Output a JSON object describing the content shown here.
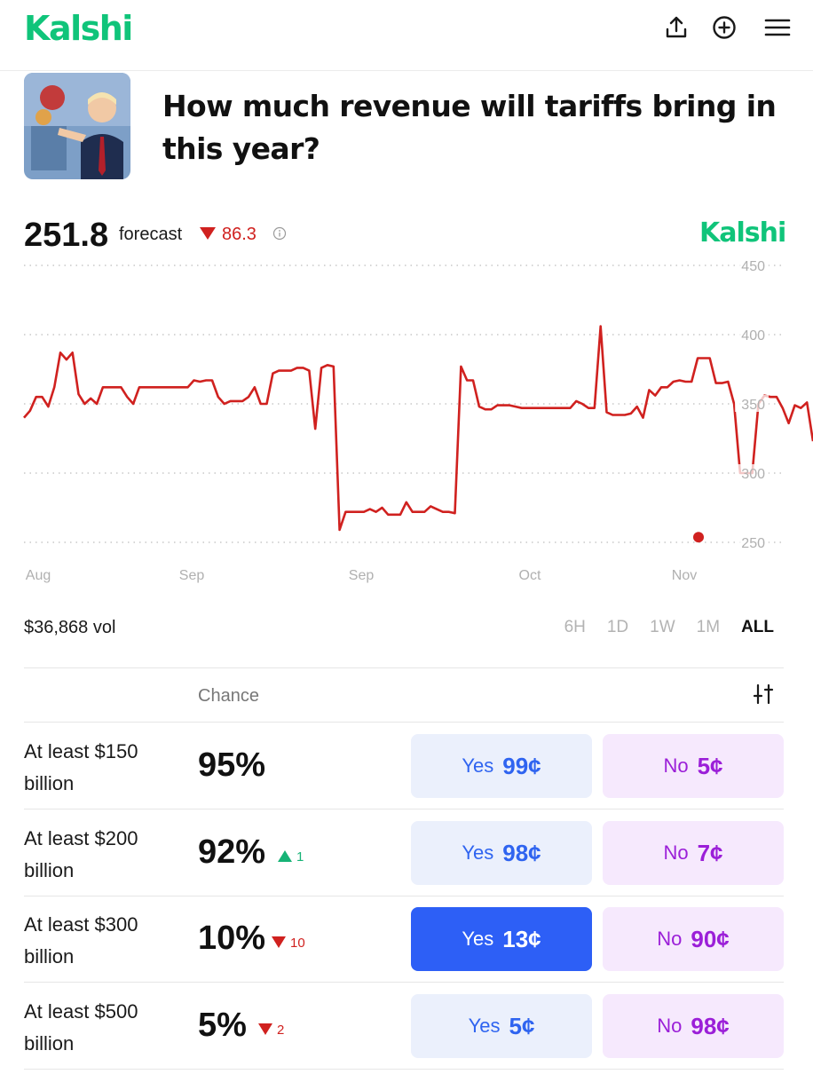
{
  "header": {
    "logo": "Kalshi",
    "brand_color": "#10c47a",
    "icons": [
      "share-icon",
      "add-circle-icon",
      "menu-icon"
    ]
  },
  "market": {
    "title": "How much revenue will tariffs bring in this year?",
    "image": "market-thumbnail"
  },
  "forecast": {
    "value": "251.8",
    "label": "forecast",
    "change": "86.3",
    "change_direction": "down",
    "watermark": "Kalshi"
  },
  "chart_data": {
    "type": "line",
    "x_tick_labels": [
      "Aug",
      "Sep",
      "Sep",
      "Oct",
      "Nov"
    ],
    "y_tick_labels": [
      "450",
      "400",
      "350",
      "300",
      "250"
    ],
    "ylim": [
      250,
      450
    ],
    "grid": true,
    "line_color": "#d0211f",
    "current_point": 251.8,
    "series": [
      {
        "values": [
          340,
          345,
          355,
          355,
          348,
          362,
          387,
          382,
          387,
          357,
          350,
          354,
          350,
          362,
          362,
          362,
          362,
          355,
          350,
          362,
          362,
          362,
          362,
          362,
          362,
          362,
          362,
          362,
          367,
          366,
          367,
          367,
          355,
          350,
          352,
          352,
          352,
          355,
          362,
          350,
          350,
          372,
          374,
          374,
          374,
          376,
          376,
          374,
          332,
          376,
          378,
          377,
          259,
          272,
          272,
          272,
          272,
          274,
          272,
          275,
          270,
          270,
          270,
          279,
          272,
          272,
          272,
          276,
          274,
          272,
          272,
          271,
          377,
          367,
          367,
          348,
          346,
          346,
          349,
          349,
          349,
          348,
          347,
          347,
          347,
          347,
          347,
          347,
          347,
          347,
          347,
          352,
          350,
          347,
          347,
          406,
          344,
          342,
          342,
          342,
          343,
          348,
          340,
          360,
          356,
          362,
          362,
          366,
          367,
          366,
          366,
          383,
          383,
          383,
          365,
          365,
          366,
          350,
          300,
          300,
          300,
          350,
          356,
          355,
          355,
          347,
          336,
          349,
          347,
          351,
          323
        ]
      }
    ]
  },
  "stats": {
    "volume": "$36,868 vol",
    "ranges": [
      "6H",
      "1D",
      "1W",
      "1M",
      "ALL"
    ],
    "active_range": "ALL"
  },
  "table": {
    "chance_header": "Chance",
    "rows": [
      {
        "label": "At least $150 billion",
        "chance": "95%",
        "delta": "",
        "delta_dir": "none",
        "yes_label": "Yes",
        "yes_price": "99¢",
        "no_label": "No",
        "no_price": "5¢",
        "yes_selected": false
      },
      {
        "label": "At least $200 billion",
        "chance": "92%",
        "delta": "1",
        "delta_dir": "up",
        "yes_label": "Yes",
        "yes_price": "98¢",
        "no_label": "No",
        "no_price": "7¢",
        "yes_selected": false
      },
      {
        "label": "At least $300 billion",
        "chance": "10%",
        "delta": "10",
        "delta_dir": "down",
        "yes_label": "Yes",
        "yes_price": "13¢",
        "no_label": "No",
        "no_price": "90¢",
        "yes_selected": true
      },
      {
        "label": "At least $500 billion",
        "chance": "5%",
        "delta": "2",
        "delta_dir": "down",
        "yes_label": "Yes",
        "yes_price": "5¢",
        "no_label": "No",
        "no_price": "98¢",
        "yes_selected": false
      }
    ]
  },
  "colors": {
    "up": "#16b376",
    "down": "#d0211f",
    "yes_text": "#2f64f0",
    "yes_bg": "#ebf0fc",
    "yes_active_bg": "#2d5ff6",
    "no_text": "#9b1fd8",
    "no_bg": "#f6e9fd"
  }
}
